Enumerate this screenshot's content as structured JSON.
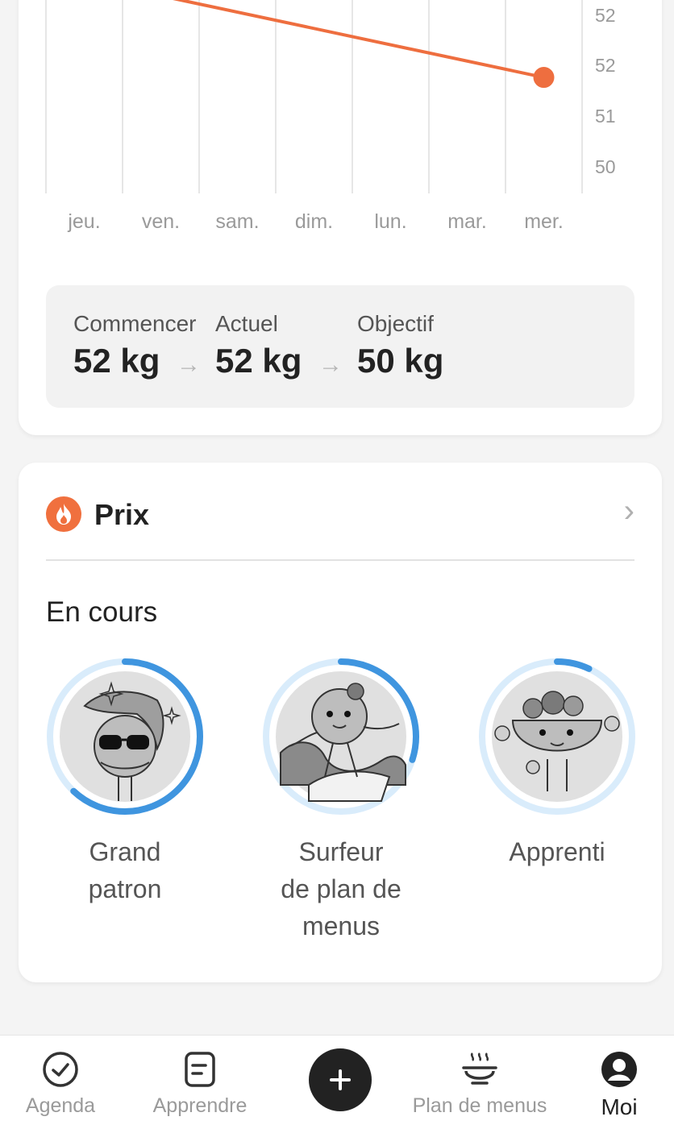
{
  "chart_data": {
    "type": "line",
    "categories": [
      "jeu.",
      "ven.",
      "sam.",
      "dim.",
      "lun.",
      "mar.",
      "mer."
    ],
    "y_tick_labels": [
      "52",
      "52",
      "51",
      "50"
    ],
    "series": [
      {
        "values": [
          null,
          null,
          null,
          null,
          null,
          null,
          51.6
        ]
      }
    ],
    "line_color": "#ee6e3f",
    "grid": true
  },
  "summary": {
    "start_label": "Commencer",
    "start_value": "52 kg",
    "current_label": "Actuel",
    "current_value": "52 kg",
    "goal_label": "Objectif",
    "goal_value": "50 kg"
  },
  "awards": {
    "title": "Prix",
    "section_title": "En cours",
    "accent_color": "#f0703e",
    "progress_color": "#3f95df",
    "items": [
      {
        "name_line1": "Grand",
        "name_line2": "patron",
        "name_line3": "",
        "progress": 0.62
      },
      {
        "name_line1": "Surfeur",
        "name_line2": "de plan de",
        "name_line3": "menus",
        "progress": 0.3
      },
      {
        "name_line1": "Apprenti",
        "name_line2": "",
        "name_line3": "",
        "progress": 0.07
      }
    ]
  },
  "nav": {
    "agenda": "Agenda",
    "learn": "Apprendre",
    "meal_plan": "Plan de menus",
    "me": "Moi"
  }
}
